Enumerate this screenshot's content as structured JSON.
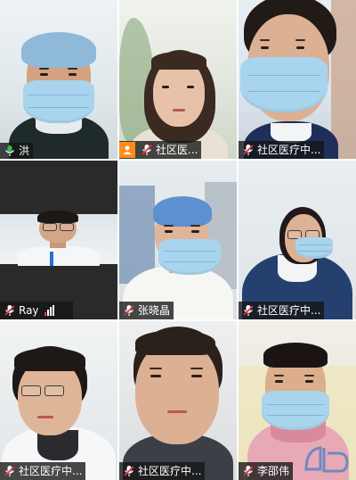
{
  "meeting": {
    "participants": [
      {
        "name": "洪",
        "tile": "top-left",
        "active_speaker": true,
        "mic": "on-green",
        "host": false
      },
      {
        "name": "社区医...",
        "tile": "top-middle",
        "active_speaker": false,
        "mic": "off-red",
        "host": true
      },
      {
        "name": "社区医疗中...",
        "tile": "top-right",
        "active_speaker": false,
        "mic": "off-red",
        "host": false
      },
      {
        "name": "Ray",
        "tile": "middle-left",
        "active_speaker": false,
        "mic": "off-red",
        "host": false,
        "signal": "weak"
      },
      {
        "name": "张晓晶",
        "tile": "center",
        "active_speaker": false,
        "mic": "off-red",
        "host": false
      },
      {
        "name": "社区医疗中...",
        "tile": "middle-right",
        "active_speaker": false,
        "mic": "off-red",
        "host": false
      },
      {
        "name": "社区医疗中...",
        "tile": "bottom-left",
        "active_speaker": false,
        "mic": "off-red",
        "host": false
      },
      {
        "name": "社区医疗中...",
        "tile": "bottom-middle",
        "active_speaker": false,
        "mic": "off-red",
        "host": false
      },
      {
        "name": "李邵伟",
        "tile": "bottom-right",
        "active_speaker": false,
        "mic": "off-red",
        "host": false
      }
    ]
  },
  "colors": {
    "active_border": "#27c24c",
    "mic_muted": "#e8303a",
    "mic_on": "#2fbf4a",
    "host_badge": "#ff8c1a",
    "mask_blue": "#a8d4ee",
    "signal_red": "#ff3b30"
  },
  "icons": {
    "muted_mic": "mic-off-icon",
    "active_mic": "mic-on-icon",
    "host": "host-person-icon",
    "signal": "signal-strength-icon"
  }
}
